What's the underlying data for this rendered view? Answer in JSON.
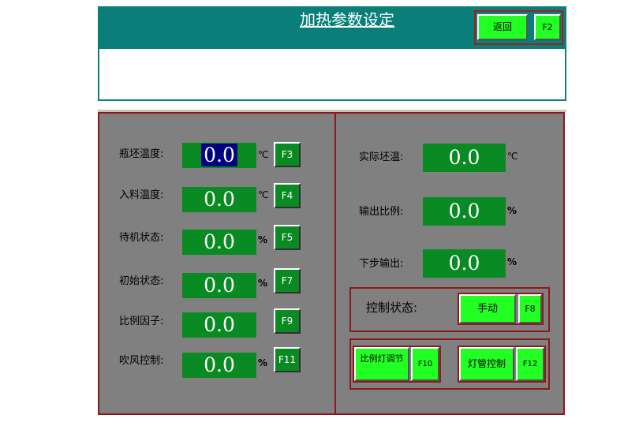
{
  "header": {
    "title": "加热参数设定",
    "back_label": "返回",
    "f2_label": "F2"
  },
  "left_panel": {
    "rows": [
      {
        "label": "瓶坯温度:",
        "value": "0.0",
        "unit": "℃",
        "key": "F3"
      },
      {
        "label": "入料温度:",
        "value": "0.0",
        "unit": "℃",
        "key": "F4"
      },
      {
        "label": "待机状态:",
        "value": "0.0",
        "unit": "%",
        "key": "F5"
      },
      {
        "label": "初始状态:",
        "value": "0.0",
        "unit": "%",
        "key": "F7"
      },
      {
        "label": "比例因子:",
        "value": "0.0",
        "unit": "",
        "key": "F9"
      },
      {
        "label": "吹风控制:",
        "value": "0.0",
        "unit": "%",
        "key": "F11"
      }
    ]
  },
  "right_panel": {
    "rows": [
      {
        "label": "实际坯温:",
        "value": "0.0",
        "unit": "℃"
      },
      {
        "label": "输出比例:",
        "value": "0.0",
        "unit": "%"
      },
      {
        "label": "下步输出:",
        "value": "0.0",
        "unit": "%"
      }
    ],
    "control_state_label": "控制状态:",
    "manual_label": "手动",
    "f8_label": "F8",
    "ratio_adjust_label": "比例灯调节",
    "f10_label": "F10",
    "lamp_control_label": "灯管控制",
    "f12_label": "F12"
  },
  "colors": {
    "header_bg": "#0a7f7a",
    "panel_bg": "#808080",
    "value_bg": "#0a8a22",
    "bright_button": "#22ff22",
    "frame_border": "#8b1a1a",
    "selection": "#000080"
  }
}
